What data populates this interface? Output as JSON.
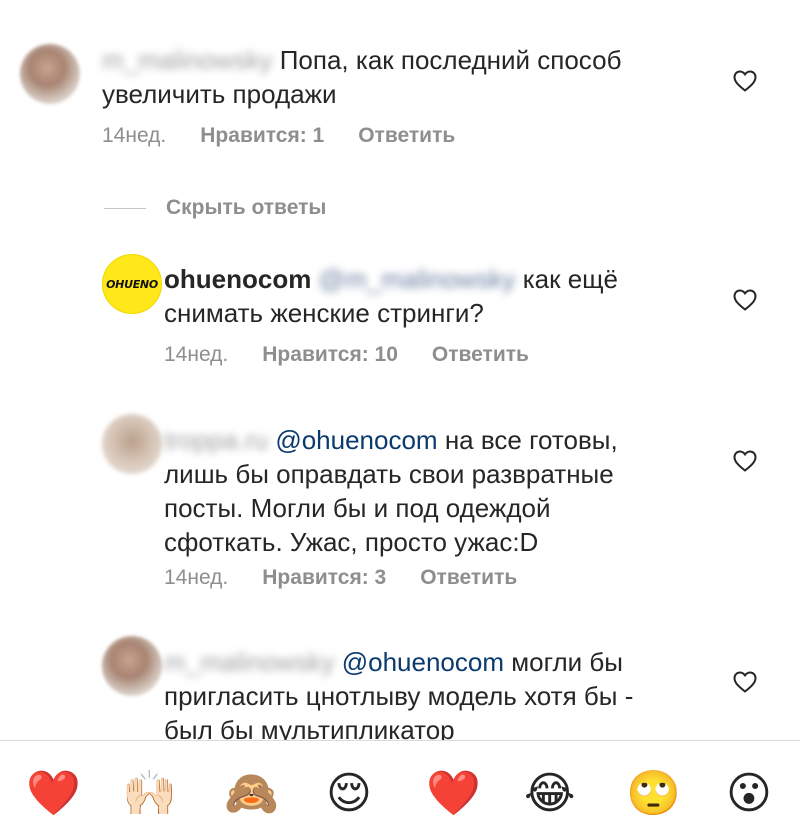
{
  "comments": [
    {
      "username": "m_malinowsky",
      "text_line1": "Попа, как последний способ",
      "text_line2": "увеличить продажи",
      "time": "14нед.",
      "likes": "Нравится: 1",
      "reply": "Ответить"
    },
    {
      "username": "ohuenocom",
      "mention_blurred": "@m_malinowsky",
      "text_line1": "как ещё",
      "text_line2": "снимать женские стринги?",
      "avatar_text": "OHUENO",
      "time": "14нед.",
      "likes": "Нравится: 10",
      "reply": "Ответить"
    },
    {
      "username": "troppa.ru",
      "mention": "@ohuenocom",
      "text_line1": "на все готовы,",
      "text_line2": "лишь бы оправдать свои развратные",
      "text_line3": "посты. Могли бы и под одеждой",
      "text_line4": "сфоткать. Ужас, просто ужас:D",
      "time": "14нед.",
      "likes": "Нравится: 3",
      "reply": "Ответить"
    },
    {
      "username": "m_malinowsky",
      "mention": "@ohuenocom",
      "text_line1": "могли бы",
      "text_line2": "пригласить цнотлыву модель хотя бы -",
      "text_line3": "был бы мультипликатор"
    }
  ],
  "hide_replies": "Скрыть ответы",
  "emoji_bar": [
    "❤️",
    "🙌🏻",
    "🙈",
    "😌",
    "❤️",
    "😂",
    "🙄",
    "😮"
  ],
  "colors": {
    "text": "#262626",
    "meta": "#8e8e8e",
    "mention": "#0a3a6e",
    "brand_yellow": "#ffe81a"
  }
}
